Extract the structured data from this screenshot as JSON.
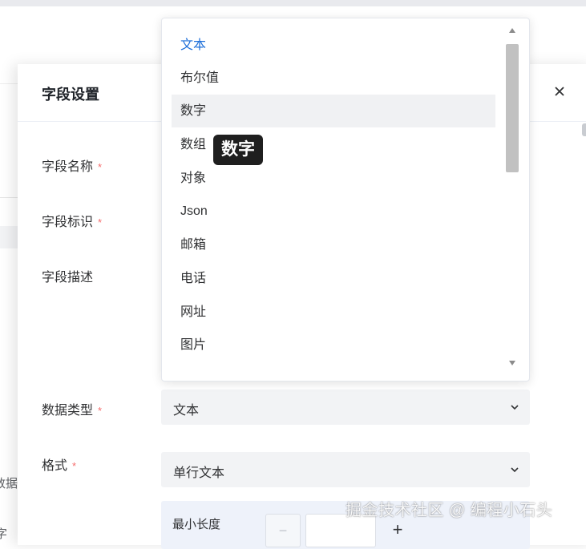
{
  "drawer": {
    "title": "字段设置",
    "close_label": "×"
  },
  "form": {
    "field_name_label": "字段名称",
    "field_id_label": "字段标识",
    "field_desc_label": "字段描述",
    "data_type_label": "数据类型",
    "format_label": "格式",
    "required_mark": "*",
    "data_type_value": "文本",
    "format_value": "单行文本",
    "min_length_label": "最小长度",
    "stepper_minus": "−",
    "stepper_plus": "+"
  },
  "background": {
    "left_partial_text": "数据",
    "left_partial_text2": "字"
  },
  "dropdown": {
    "options": [
      "文本",
      "布尔值",
      "数字",
      "数组",
      "对象",
      "Json",
      "邮箱",
      "电话",
      "网址",
      "图片"
    ],
    "selected_option": "文本",
    "hovered_option": "数字"
  },
  "tooltip": {
    "text": "数字"
  },
  "watermark": {
    "text": "掘金技术社区 @ 编程小石头"
  },
  "colors": {
    "accent": "#1e6fd9",
    "required": "#f56c6c",
    "select_bg": "#f2f3f5",
    "tooltip_bg": "#1f1f1f"
  },
  "icons": {
    "close": "close-icon",
    "select_arrow": "chevron-down-icon",
    "scroll_up": "scroll-up-arrow-icon",
    "scroll_down": "scroll-down-arrow-icon"
  }
}
